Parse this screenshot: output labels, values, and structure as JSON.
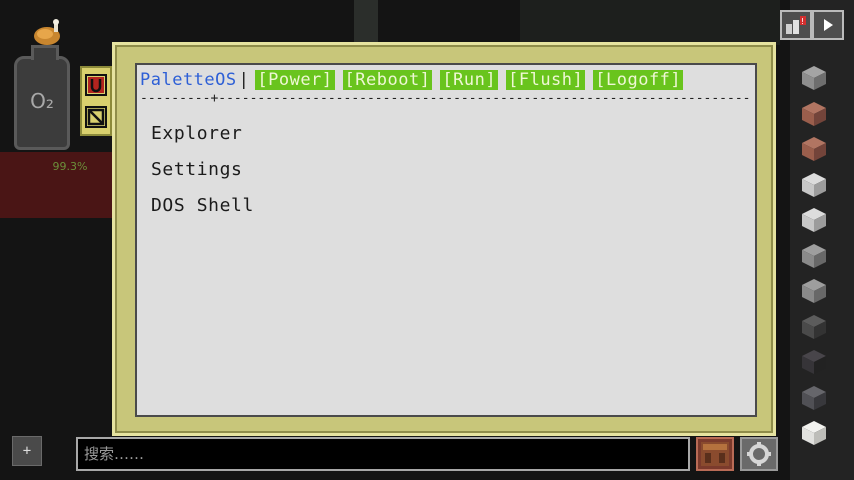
{
  "hud": {
    "o2_label": "O₂",
    "o2_percent": "99.3%",
    "food_icon": "roast-chicken-icon",
    "toggle_icons": [
      "magnet-icon",
      "no-entry-icon"
    ]
  },
  "terminal": {
    "os_name": "PaletteOS",
    "separator": "|",
    "menu": [
      "[Power]",
      "[Reboot]",
      "[Run]",
      "[Flush]",
      "[Logoff]"
    ],
    "rule": "---------+---------------------------------------------------------------------",
    "apps": [
      "Explorer",
      "Settings",
      "DOS Shell"
    ],
    "colors": {
      "os_name": "#2d5fd6",
      "menu_bg": "#69c41d",
      "screen_bg": "#dedede",
      "frame": "#c8c67a"
    }
  },
  "side_slots": {
    "items": [
      "stone-block-icon",
      "granite-block-icon",
      "granite-block-icon",
      "diorite-block-icon",
      "diorite-block-icon",
      "andesite-block-icon",
      "andesite-block-icon",
      "basalt-block-icon",
      "blackstone-block-icon",
      "deepslate-block-icon",
      "calcite-block-icon"
    ]
  },
  "top_right": {
    "buttons": [
      "tools-icon",
      "next-page-icon"
    ],
    "alert_badge": "!"
  },
  "bottom": {
    "plus_label": "+",
    "search_placeholder": "搜索……",
    "craft_icon": "crafting-table-icon",
    "settings_icon": "gear-icon"
  }
}
